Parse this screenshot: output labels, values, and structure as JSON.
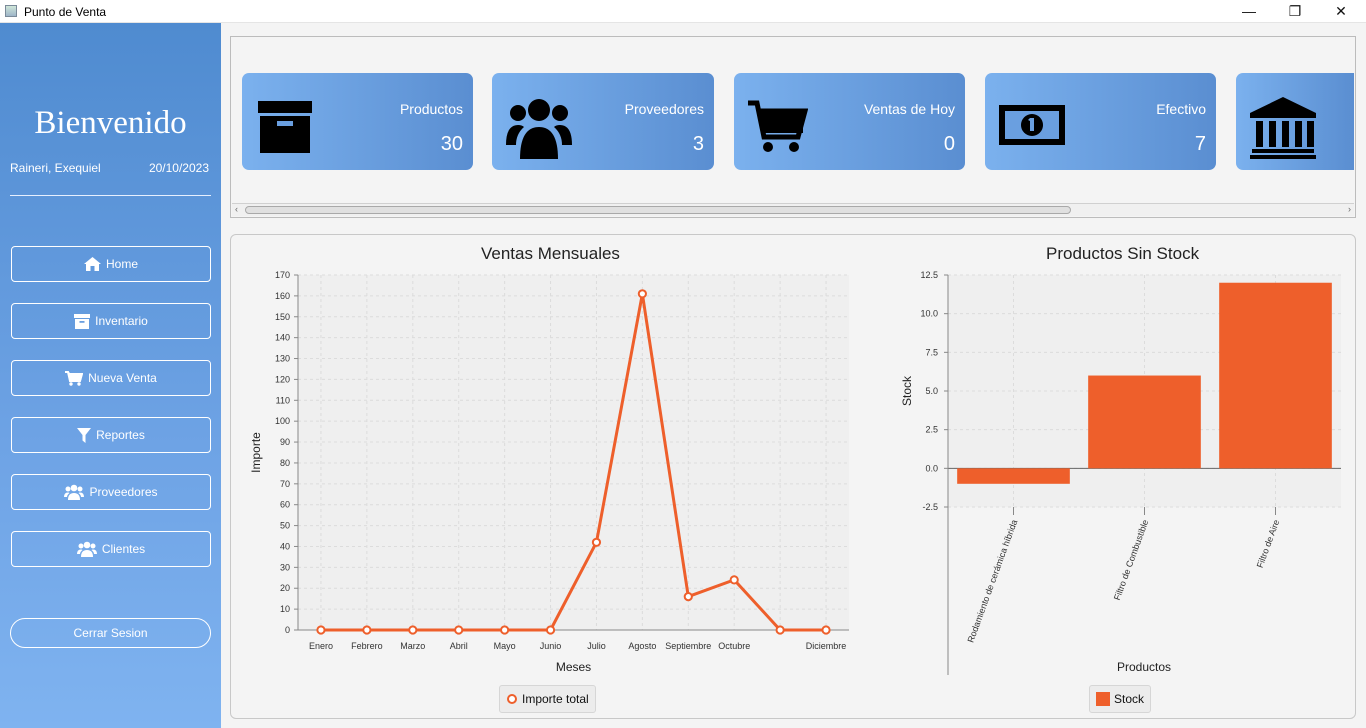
{
  "window": {
    "title": "Punto de Venta",
    "minimize": "—",
    "maximize": "❐",
    "close": "✕"
  },
  "sidebar": {
    "welcome": "Bienvenido",
    "user": "Raineri, Exequiel",
    "date": "20/10/2023",
    "items": [
      {
        "label": "Home",
        "icon": "home-icon"
      },
      {
        "label": "Inventario",
        "icon": "archive-icon"
      },
      {
        "label": "Nueva Venta",
        "icon": "cart-icon"
      },
      {
        "label": "Reportes",
        "icon": "filter-icon"
      },
      {
        "label": "Proveedores",
        "icon": "users-icon"
      },
      {
        "label": "Clientes",
        "icon": "users-icon"
      }
    ],
    "logout": "Cerrar Sesion"
  },
  "cards": [
    {
      "label": "Productos",
      "value": "30",
      "icon": "archive-icon"
    },
    {
      "label": "Proveedores",
      "value": "3",
      "icon": "users-icon"
    },
    {
      "label": "Ventas de Hoy",
      "value": "0",
      "icon": "cart-icon"
    },
    {
      "label": "Efectivo",
      "value": "7",
      "icon": "money-icon"
    },
    {
      "label": "",
      "value": "",
      "icon": "bank-icon"
    }
  ],
  "colors": {
    "accent": "#ee5f2b",
    "card_start": "#7bb1ee",
    "card_end": "#5a8ed1",
    "sidebar": "#5b95da"
  },
  "chart_data": [
    {
      "type": "line",
      "title": "Ventas Mensuales",
      "xlabel": "Meses",
      "ylabel": "Importe",
      "categories": [
        "Enero",
        "Febrero",
        "Marzo",
        "Abril",
        "Mayo",
        "Junio",
        "Julio",
        "Agosto",
        "Septiembre",
        "Octubre",
        "",
        "Diciembre"
      ],
      "series": [
        {
          "name": "Importe total",
          "values": [
            0,
            0,
            0,
            0,
            0,
            0,
            42,
            161,
            16,
            24,
            0,
            0
          ]
        }
      ],
      "ylim": [
        0,
        170
      ],
      "yticks": [
        0,
        10,
        20,
        30,
        40,
        50,
        60,
        70,
        80,
        90,
        100,
        110,
        120,
        130,
        140,
        150,
        160,
        170
      ],
      "grid": true,
      "legend": "bottom"
    },
    {
      "type": "bar",
      "title": "Productos Sin Stock",
      "xlabel": "Productos",
      "ylabel": "Stock",
      "categories": [
        "Rodamiento de cerámica híbrida",
        "Filtro de Combustible",
        "Filtro de Aire"
      ],
      "series": [
        {
          "name": "Stock",
          "values": [
            -1,
            6,
            12
          ]
        }
      ],
      "ylim": [
        -2.5,
        12.5
      ],
      "yticks": [
        "-2.5",
        "0.0",
        "2.5",
        "5.0",
        "7.5",
        "10.0",
        "12.5"
      ],
      "grid": true,
      "legend": "bottom"
    }
  ]
}
